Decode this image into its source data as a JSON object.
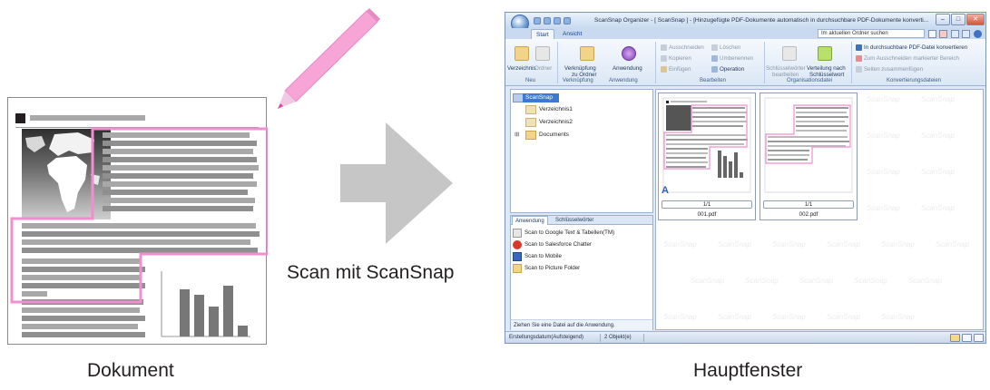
{
  "captions": {
    "scan": "Scan mit ScanSnap",
    "document": "Dokument",
    "main_window": "Hauptfenster"
  },
  "colors": {
    "highlight": "#f08ecf",
    "arrow": "#c6c6c6",
    "pencil_body": "#f7a4d6",
    "pencil_tip": "#e03fa6",
    "selection": "#3b79d3"
  },
  "window": {
    "title": "ScanSnap Organizer - [ ScanSnap ] - [Hinzugefügte PDF-Dokumente automatisch in durchsuchbare PDF-Dokumente konverti...",
    "tabs": [
      "Start",
      "Ansicht"
    ],
    "search_placeholder": "Im aktuellen Ordner suchen",
    "ribbon": {
      "neu": {
        "verzeichnis": "Verzeichnis",
        "ordner": "Ordner",
        "label": "Neu"
      },
      "verknuepfung": {
        "button_line1": "Verknüpfung",
        "button_line2": "zu Ordner",
        "label": "Verknüpfung"
      },
      "anwendung": {
        "button": "Anwendung",
        "label": "Anwendung"
      },
      "bearbeiten": {
        "ausschneiden": "Ausschneiden",
        "kopieren": "Kopieren",
        "einfuegen": "Einfügen",
        "loeschen": "Löschen",
        "umbenennen": "Umbenennen",
        "operation": "Operation",
        "label": "Bearbeiten"
      },
      "organisation": {
        "schluesselwoerter_line1": "Schlüsselwörter",
        "schluesselwoerter_line2": "bearbeiten",
        "verteilung_line1": "Verteilung nach",
        "verteilung_line2": "Schlüsselwort",
        "label": "Organisationsdatei"
      },
      "konvertierung": {
        "convert_pdf": "In durchsuchbare PDF-Datei konvertieren",
        "zoom_area": "Zum Ausschneiden markierter Bereich",
        "merge_pages": "Seiten zusammenfügen",
        "label": "Konvertierungsdateien"
      }
    },
    "tree": {
      "root": "ScanSnap",
      "items": [
        "Verzeichnis1",
        "Verzeichnis2",
        "Documents"
      ]
    },
    "apps_panel": {
      "tabs": [
        "Anwendung",
        "Schlüsselwörter"
      ],
      "items": [
        "Scan to Google Text & Tabellen(TM)",
        "Scan to Salesforce Chatter",
        "Scan to Mobile",
        "Scan to Picture Folder"
      ],
      "hint": "Ziehen Sie eine Datei auf die Anwendung."
    },
    "files": [
      {
        "page": "1/1",
        "name": "001.pdf"
      },
      {
        "page": "1/1",
        "name": "002.pdf"
      }
    ],
    "ocr_mark": "A",
    "watermark": "ScanSnap",
    "status": {
      "sort": "Erstellungsdatum(Aufsteigend)",
      "count": "2 Objekt(e)"
    }
  }
}
